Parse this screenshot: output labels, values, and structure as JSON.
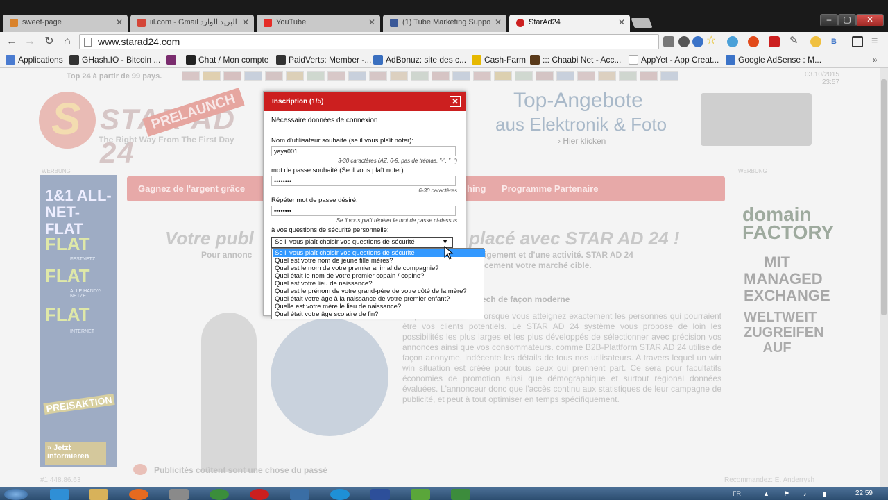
{
  "tabs": [
    {
      "label": "sweet-page",
      "color": "#d9822b"
    },
    {
      "label": "iil.com - Gmail البريد الوارد",
      "color": "#d44638"
    },
    {
      "label": "YouTube",
      "color": "#e52d27"
    },
    {
      "label": "(1) Tube Marketing Suppo",
      "color": "#3b5998"
    },
    {
      "label": "StarAd24",
      "color": "#cc1f1f"
    }
  ],
  "window": {
    "minimize": "–",
    "maximize": "▢",
    "close": "✕"
  },
  "address": {
    "url": "www.starad24.com"
  },
  "bookmarks": [
    {
      "label": "Applications",
      "color": "#4a7bd0"
    },
    {
      "label": "GHash.IO - Bitcoin ...",
      "color": "#333333"
    },
    {
      "label": "",
      "color": "#7a2c6e"
    },
    {
      "label": "Chat / Mon compte",
      "color": "#222222"
    },
    {
      "label": "PaidVerts: Member -...",
      "color": "#333333"
    },
    {
      "label": "AdBonuz: site des c...",
      "color": "#3a6fbf"
    },
    {
      "label": "Cash-Farm",
      "color": "#e6b800"
    },
    {
      "label": "::: Chaabi Net - Acc...",
      "color": "#5a3a1a"
    },
    {
      "label": "AppYet - App Creat...",
      "color": "#cccccc"
    },
    {
      "label": "Google AdSense : M...",
      "color": "#3b73c8"
    }
  ],
  "page": {
    "top24": "Top 24 à partir de 99 pays.",
    "date": [
      "03.10/2015",
      "23:57"
    ],
    "logo_s": "S",
    "logo_name": "STAR AD 24",
    "logo_prelaunch": "PRELAUNCH",
    "logo_slogan": "The Right Way From The First Day",
    "ad_title": "Top-Angebote",
    "ad_subtitle": "aus Elektronik & Foto",
    "ad_link": "› Hier klicken",
    "ad_label_left": "WERBUNG",
    "ad_label_right": "WERBUNG",
    "left_ad_title": "1&1 ALL-NET-FLAT",
    "left_ad_flat": "FLAT",
    "left_ad_sub1": "FESTNETZ",
    "left_ad_sub2": "ALLE HANDY-NETZE",
    "left_ad_sub3": "INTERNET",
    "left_ad_promo": "PREISAKTION",
    "left_ad_info": "» Jetzt informieren",
    "nav_items": [
      "Gagnez de l'argent grâce",
      "hing",
      "Programme Partenaire"
    ],
    "right_ad_brand": "domain FACTORY",
    "right_ad_line1": "MIT MANAGED EXCHANGE",
    "right_ad_line2": "WELTWEIT ZUGREIFEN AUF",
    "headline_left": "Votre publ",
    "headline_right": "placé avec STAR AD 24 !",
    "sub_left": "Pour annonc",
    "sub_right": "igement et d'une activité. STAR AD 24 cement votre marché cible.",
    "tech": "tech de façon moderne",
    "body": "ne peut être efficace lorsque vous atteignez exactement les personnes qui pourraient être vos clients potentiels. Le STAR AD 24 système vous propose de loin les possibilités les plus larges et les plus développés de sélectionner avec précision vos annonces ainsi que vos consommateurs. comme B2B-Plattform STAR AD 24 utilise de façon anonyme, indécente les détails de tous nos utilisateurs. A travers lequel un win win situation est créée pour tous ceux qui prennent part. Ce sera pour facultatifs économies de promotion ainsi que démographique et surtout régional données évaluées. L'annonceur donc que l'accès continu aux statistiques de leur campagne de publicité, et peut à tout optimiser en temps spécifiquement.",
    "pub": "Publicités coûtent sont une chose du passé",
    "footer_left": "#1.448.86.63",
    "footer_right": "Recommandez: E. Anderrysh"
  },
  "modal": {
    "title": "Inscription (1/5)",
    "close": "✕",
    "section": "Nécessaire données de connexion",
    "username_label": "Nom d'utilisateur souhaité (se il vous plaît noter):",
    "username_value": "yaya001",
    "username_hint": "3-30 caractères (AZ, 0-9, pas de trémas, \"-\", \"_\")",
    "password_label": "mot de passe souhaité (Se il vous plaît noter):",
    "password_value": "••••••••",
    "password_hint": "6-30 caractères",
    "repeat_label": "Répéter mot de passe désiré:",
    "repeat_value": "••••••••",
    "repeat_hint": "Se il vous plaît répéter le mot de passe ci-dessus",
    "security_label": "à vos questions de sécurité personnelle:",
    "security_selected": "Se il vous plaît choisir vos questions de sécurité",
    "security_options": [
      "Se il vous plaît choisir vos questions de sécurité",
      "Quel est votre nom de jeune fille mères?",
      "Quel est le nom de votre premier animal de compagnie?",
      "Quel était le nom de votre premier copain / copine?",
      "Quel est votre lieu de naissance?",
      "Quel est le prénom de votre grand-père de votre côté de la mère?",
      "Quel était votre âge à la naissance de votre premier enfant?",
      "Quelle est votre mère le lieu de naissance?",
      "Quel était votre âge scolaire de fin?"
    ]
  },
  "taskbar": {
    "apps": [
      "#3a6ea5",
      "#2f8fd6",
      "#d8b25a",
      "#e66a1f",
      "#8a8a8a",
      "#3b8e3b",
      "#cc1f1f",
      "#3a6ea5",
      "#1e90d6",
      "#2d4f9a",
      "#5aa63a",
      "#3c8c3c"
    ],
    "lang": "FR",
    "clock": "22:59"
  }
}
